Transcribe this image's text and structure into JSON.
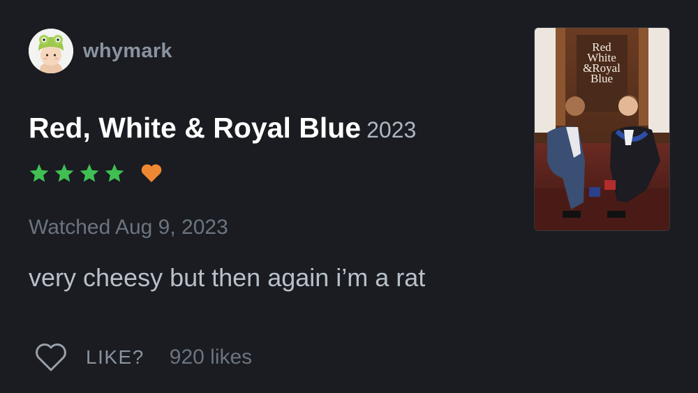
{
  "user": {
    "username": "whymark",
    "avatar_icon": "frog-hat-doll-avatar"
  },
  "film": {
    "title": "Red, White & Royal Blue",
    "year": "2023",
    "poster_title_lines": [
      "Red",
      "White",
      "&Royal",
      "Blue"
    ]
  },
  "rating": {
    "stars": 4,
    "max_stars": 5,
    "star_color": "#40bf53",
    "liked": true,
    "liked_color": "#ef8833"
  },
  "watched_text": "Watched Aug 9, 2023",
  "review_text": "very cheesy but then again i’m a rat",
  "footer": {
    "like_label": "LIKE?",
    "likes_count": "920 likes"
  }
}
